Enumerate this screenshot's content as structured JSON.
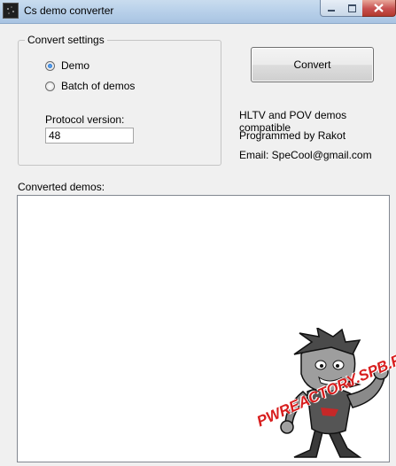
{
  "window": {
    "title": "Cs demo converter",
    "controls": {
      "minimize": "minimize-icon",
      "maximize": "maximize-icon",
      "close": "close-icon"
    }
  },
  "convert_settings": {
    "legend": "Convert settings",
    "options": [
      {
        "label": "Demo",
        "checked": true
      },
      {
        "label": "Batch of demos",
        "checked": false
      }
    ],
    "protocol_label": "Protocol version:",
    "protocol_value": "48"
  },
  "convert_button": {
    "label": "Convert"
  },
  "info": {
    "line1": "HLTV and POV demos compatible",
    "line2": "Programmed by Rakot",
    "line3": "Email: SpeCool@gmail.com"
  },
  "converted": {
    "label": "Converted demos:",
    "items": []
  },
  "watermark": {
    "text": "PWREACTORY.SPB.RU"
  },
  "colors": {
    "accent_radio": "#1d5fb8",
    "watermark": "#d81e1e",
    "close_button": "#c75050"
  }
}
